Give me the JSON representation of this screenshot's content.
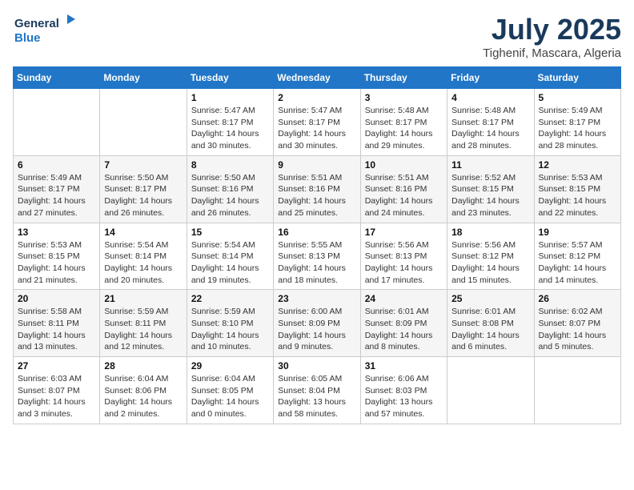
{
  "header": {
    "logo_line1": "General",
    "logo_line2": "Blue",
    "month": "July 2025",
    "location": "Tighenif, Mascara, Algeria"
  },
  "weekdays": [
    "Sunday",
    "Monday",
    "Tuesday",
    "Wednesday",
    "Thursday",
    "Friday",
    "Saturday"
  ],
  "weeks": [
    [
      {
        "day": "",
        "info": ""
      },
      {
        "day": "",
        "info": ""
      },
      {
        "day": "1",
        "info": "Sunrise: 5:47 AM\nSunset: 8:17 PM\nDaylight: 14 hours\nand 30 minutes."
      },
      {
        "day": "2",
        "info": "Sunrise: 5:47 AM\nSunset: 8:17 PM\nDaylight: 14 hours\nand 30 minutes."
      },
      {
        "day": "3",
        "info": "Sunrise: 5:48 AM\nSunset: 8:17 PM\nDaylight: 14 hours\nand 29 minutes."
      },
      {
        "day": "4",
        "info": "Sunrise: 5:48 AM\nSunset: 8:17 PM\nDaylight: 14 hours\nand 28 minutes."
      },
      {
        "day": "5",
        "info": "Sunrise: 5:49 AM\nSunset: 8:17 PM\nDaylight: 14 hours\nand 28 minutes."
      }
    ],
    [
      {
        "day": "6",
        "info": "Sunrise: 5:49 AM\nSunset: 8:17 PM\nDaylight: 14 hours\nand 27 minutes."
      },
      {
        "day": "7",
        "info": "Sunrise: 5:50 AM\nSunset: 8:17 PM\nDaylight: 14 hours\nand 26 minutes."
      },
      {
        "day": "8",
        "info": "Sunrise: 5:50 AM\nSunset: 8:16 PM\nDaylight: 14 hours\nand 26 minutes."
      },
      {
        "day": "9",
        "info": "Sunrise: 5:51 AM\nSunset: 8:16 PM\nDaylight: 14 hours\nand 25 minutes."
      },
      {
        "day": "10",
        "info": "Sunrise: 5:51 AM\nSunset: 8:16 PM\nDaylight: 14 hours\nand 24 minutes."
      },
      {
        "day": "11",
        "info": "Sunrise: 5:52 AM\nSunset: 8:15 PM\nDaylight: 14 hours\nand 23 minutes."
      },
      {
        "day": "12",
        "info": "Sunrise: 5:53 AM\nSunset: 8:15 PM\nDaylight: 14 hours\nand 22 minutes."
      }
    ],
    [
      {
        "day": "13",
        "info": "Sunrise: 5:53 AM\nSunset: 8:15 PM\nDaylight: 14 hours\nand 21 minutes."
      },
      {
        "day": "14",
        "info": "Sunrise: 5:54 AM\nSunset: 8:14 PM\nDaylight: 14 hours\nand 20 minutes."
      },
      {
        "day": "15",
        "info": "Sunrise: 5:54 AM\nSunset: 8:14 PM\nDaylight: 14 hours\nand 19 minutes."
      },
      {
        "day": "16",
        "info": "Sunrise: 5:55 AM\nSunset: 8:13 PM\nDaylight: 14 hours\nand 18 minutes."
      },
      {
        "day": "17",
        "info": "Sunrise: 5:56 AM\nSunset: 8:13 PM\nDaylight: 14 hours\nand 17 minutes."
      },
      {
        "day": "18",
        "info": "Sunrise: 5:56 AM\nSunset: 8:12 PM\nDaylight: 14 hours\nand 15 minutes."
      },
      {
        "day": "19",
        "info": "Sunrise: 5:57 AM\nSunset: 8:12 PM\nDaylight: 14 hours\nand 14 minutes."
      }
    ],
    [
      {
        "day": "20",
        "info": "Sunrise: 5:58 AM\nSunset: 8:11 PM\nDaylight: 14 hours\nand 13 minutes."
      },
      {
        "day": "21",
        "info": "Sunrise: 5:59 AM\nSunset: 8:11 PM\nDaylight: 14 hours\nand 12 minutes."
      },
      {
        "day": "22",
        "info": "Sunrise: 5:59 AM\nSunset: 8:10 PM\nDaylight: 14 hours\nand 10 minutes."
      },
      {
        "day": "23",
        "info": "Sunrise: 6:00 AM\nSunset: 8:09 PM\nDaylight: 14 hours\nand 9 minutes."
      },
      {
        "day": "24",
        "info": "Sunrise: 6:01 AM\nSunset: 8:09 PM\nDaylight: 14 hours\nand 8 minutes."
      },
      {
        "day": "25",
        "info": "Sunrise: 6:01 AM\nSunset: 8:08 PM\nDaylight: 14 hours\nand 6 minutes."
      },
      {
        "day": "26",
        "info": "Sunrise: 6:02 AM\nSunset: 8:07 PM\nDaylight: 14 hours\nand 5 minutes."
      }
    ],
    [
      {
        "day": "27",
        "info": "Sunrise: 6:03 AM\nSunset: 8:07 PM\nDaylight: 14 hours\nand 3 minutes."
      },
      {
        "day": "28",
        "info": "Sunrise: 6:04 AM\nSunset: 8:06 PM\nDaylight: 14 hours\nand 2 minutes."
      },
      {
        "day": "29",
        "info": "Sunrise: 6:04 AM\nSunset: 8:05 PM\nDaylight: 14 hours\nand 0 minutes."
      },
      {
        "day": "30",
        "info": "Sunrise: 6:05 AM\nSunset: 8:04 PM\nDaylight: 13 hours\nand 58 minutes."
      },
      {
        "day": "31",
        "info": "Sunrise: 6:06 AM\nSunset: 8:03 PM\nDaylight: 13 hours\nand 57 minutes."
      },
      {
        "day": "",
        "info": ""
      },
      {
        "day": "",
        "info": ""
      }
    ]
  ]
}
